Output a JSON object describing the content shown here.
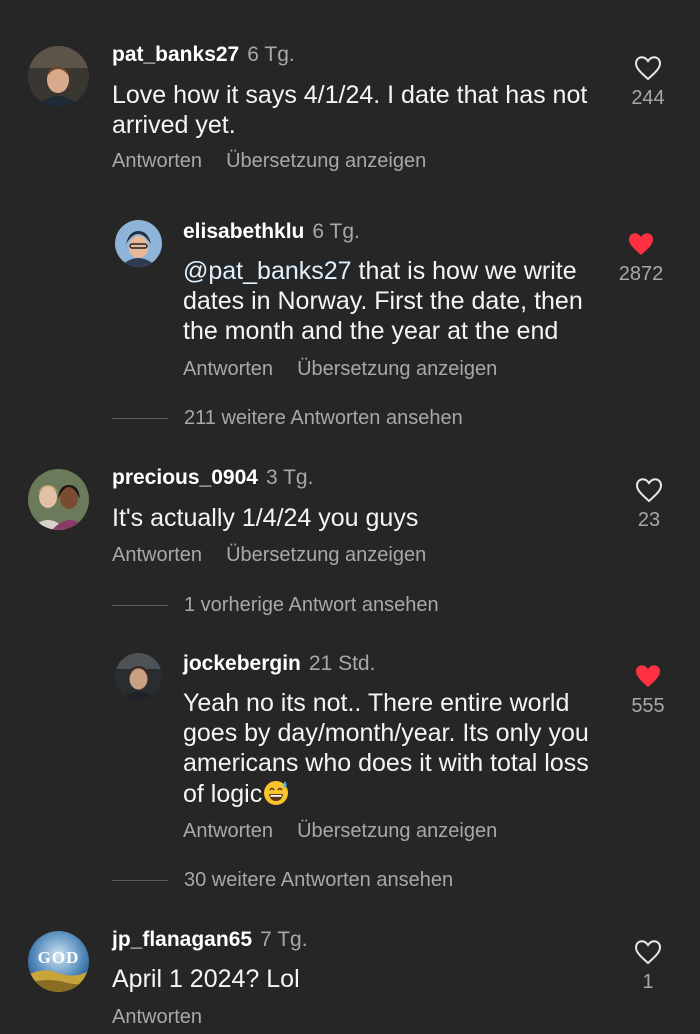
{
  "comments": [
    {
      "username": "pat_banks27",
      "time": "6 Tg.",
      "text": "Love how it says 4/1/24.  I date that has not arrived yet.",
      "reply_label": "Antworten",
      "translate_label": "Übersetzung anzeigen",
      "likes": "244",
      "liked": false,
      "replies": [
        {
          "username": "elisabethklu",
          "time": "6 Tg.",
          "mention": "@pat_banks27",
          "text": " that is how we write dates in Norway. First the date, then the month and the year at the end",
          "reply_label": "Antworten",
          "translate_label": "Übersetzung anzeigen",
          "likes": "2872",
          "liked": true
        }
      ],
      "more_replies": "211 weitere Antworten ansehen"
    },
    {
      "username": "precious_0904",
      "time": "3 Tg.",
      "text": "It's actually 1/4/24 you guys",
      "reply_label": "Antworten",
      "translate_label": "Übersetzung anzeigen",
      "likes": "23",
      "liked": false,
      "previous_replies": "1 vorherige Antwort ansehen",
      "replies": [
        {
          "username": "jockebergin",
          "time": "21 Std.",
          "text": "Yeah no its not.. There entire world goes by day/month/year. Its only you americans who does it with total loss of logic",
          "emoji": "grinning-sweat-emoji",
          "reply_label": "Antworten",
          "translate_label": "Übersetzung anzeigen",
          "likes": "555",
          "liked": true
        }
      ],
      "more_replies": "30 weitere Antworten ansehen"
    },
    {
      "username": "jp_flanagan65",
      "time": "7 Tg.",
      "text": "April 1 2024? Lol",
      "reply_label": "Antworten",
      "likes": "1",
      "liked": false,
      "avatar_text": "GOD"
    }
  ],
  "colors": {
    "background": "#262626",
    "liked_heart": "#ff3040",
    "secondary_text": "#a8a8a8"
  },
  "icons": {
    "like": "heart-outline-icon",
    "liked": "heart-filled-icon"
  }
}
